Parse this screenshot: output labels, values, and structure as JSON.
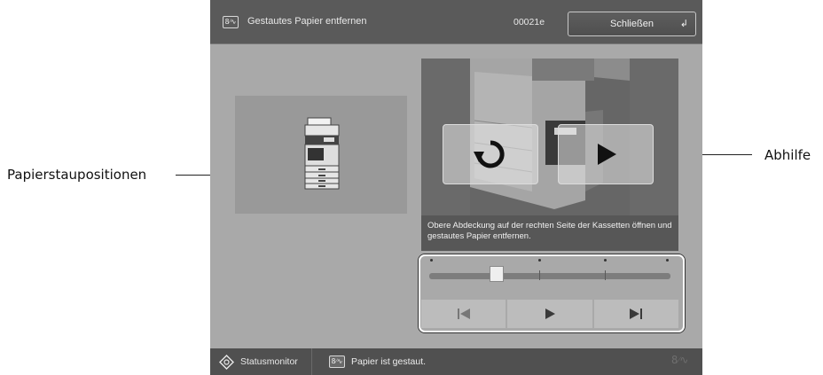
{
  "topbar": {
    "title": "Gestautes Papier entfernen",
    "code": "00021e",
    "close_label": "Schließen",
    "close_icon": "return-arrow-icon"
  },
  "video": {
    "caption": "Obere Abdeckung auf der rechten Seite der Kassetten öffnen und gestautes Papier entfernen."
  },
  "playback": {
    "position": 0.29,
    "chapter_marks": 4
  },
  "bottombar": {
    "status_monitor_label": "Statusmonitor",
    "message": "Papier ist gestaut."
  },
  "callouts": {
    "left": "Papierstaupositionen",
    "right": "Abhilfe"
  }
}
